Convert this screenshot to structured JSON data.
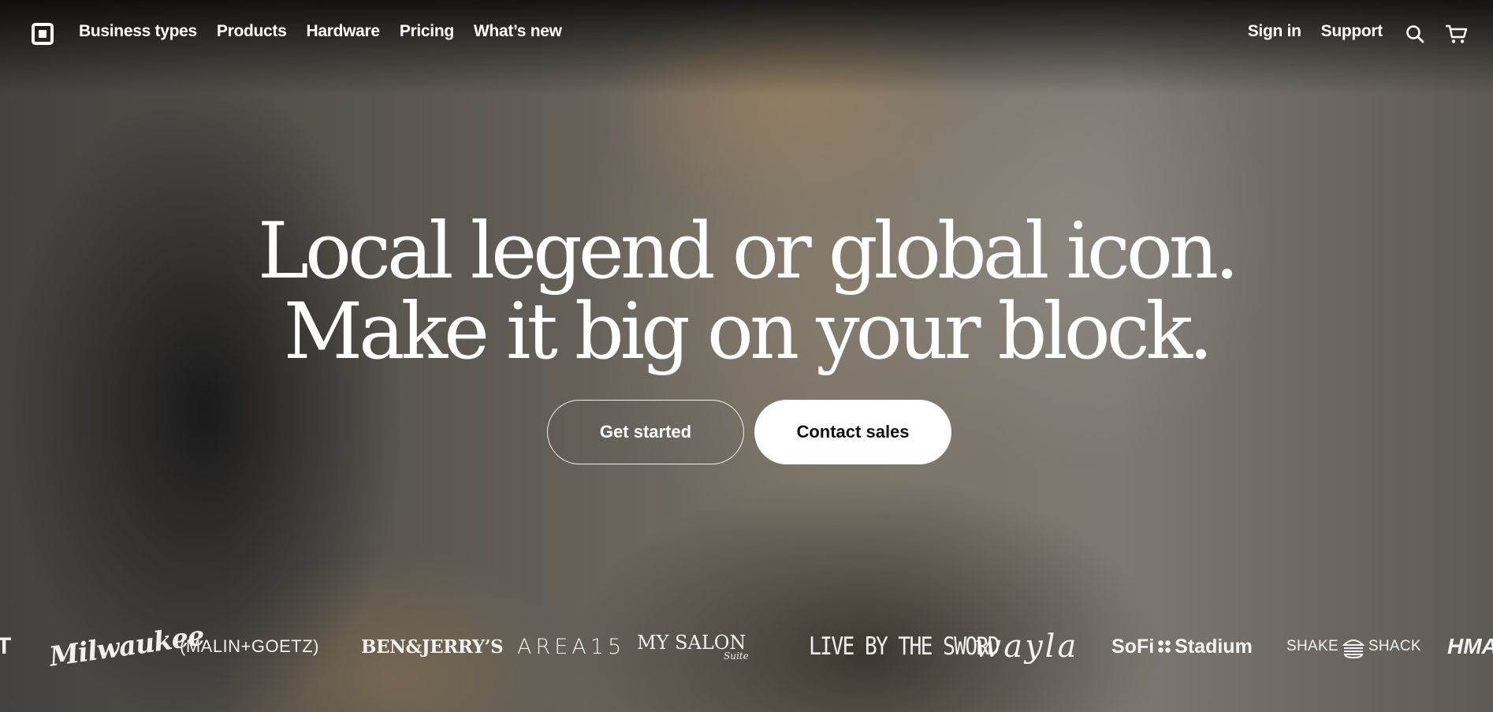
{
  "nav": {
    "logo_icon": "square-logo-icon",
    "links": [
      "Business types",
      "Products",
      "Hardware",
      "Pricing",
      "What’s new"
    ],
    "sign_in": "Sign in",
    "support": "Support",
    "search_icon": "search-icon",
    "cart_icon": "cart-icon"
  },
  "hero": {
    "headline_line1": "Local legend or global icon.",
    "headline_line2": "Make it big on your block.",
    "primary_button": "Get started",
    "secondary_button": "Contact sales"
  },
  "logos": {
    "t_fragment": "T",
    "milwaukee": "Milwaukee",
    "malin_goetz": "(MALIN+GOETZ)",
    "ben_jerrys": "BEN&JERRY’S",
    "area15": "AREA15",
    "my_salon": "MY SALON",
    "my_salon_sub": "Suite",
    "live_by_the_sword": "LIVE BY THE SWORD",
    "wayla": "wayla",
    "sofi": "SoFi",
    "sofi_stadium": "Stadium",
    "shake": "SHAKE",
    "shack": "SHACK",
    "hm_fragment": "HMA"
  },
  "colors": {
    "text": "#ffffff",
    "solid_button_bg": "#ffffff",
    "solid_button_text": "#111111"
  }
}
